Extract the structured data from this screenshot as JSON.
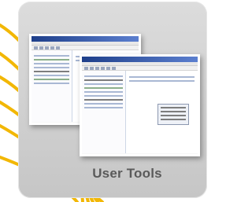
{
  "tile": {
    "label": "User Tools",
    "icon": "application-screenshots-icon"
  },
  "colors": {
    "tile_background": "#d0d0d0",
    "label_text": "#5a5a5a",
    "accent_swoosh": "#f2b705"
  }
}
